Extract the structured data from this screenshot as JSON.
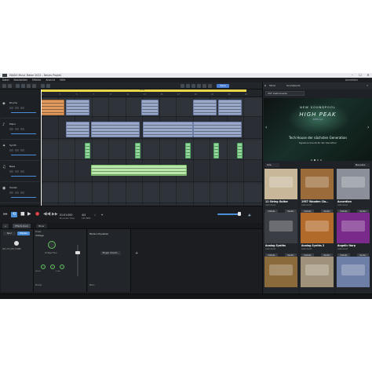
{
  "window": {
    "title": "MAGIX Music Maker 2022 – Neues Projekt",
    "controls": [
      "–",
      "☐",
      "✕"
    ]
  },
  "menu": [
    "Datei",
    "Bearbeiten",
    "Effekte",
    "Ansicht",
    "Hilfe"
  ],
  "toolbar": {
    "action_label": "Save"
  },
  "right_top": {
    "account_label": "Anmelden"
  },
  "ruler": {
    "loop_label": "Loop",
    "ticks": [
      "1",
      "3",
      "5",
      "7",
      "9",
      "11",
      "13",
      "15",
      "17",
      "19",
      "21",
      "23",
      "25"
    ]
  },
  "tracks": [
    {
      "name": "Drums",
      "icon": "drum-icon",
      "glyph": "◈"
    },
    {
      "name": "Piano",
      "icon": "keys-icon",
      "glyph": "♪"
    },
    {
      "name": "Synth",
      "icon": "synth-icon",
      "glyph": "✦"
    },
    {
      "name": "Bass",
      "icon": "bass-icon",
      "glyph": "♫"
    },
    {
      "name": "Vocals",
      "icon": "mic-icon",
      "glyph": "◉"
    }
  ],
  "transport": {
    "position": "01:01:000",
    "position_sub": "No Audio Time",
    "tempo": "4/4",
    "tempo_sub": "120 BPM"
  },
  "fx_tabs": [
    "Effects Rack",
    "Mixer"
  ],
  "bottom": {
    "channel_tab_a": "Spur",
    "channel_tab_b": "Master",
    "preset_label": "Preset",
    "track_name": "003_07X_DRY_TURBO",
    "plugin_title": "Vintage",
    "plugin_knob_label": "Vintage Tone",
    "plugin_bottom": "250 Hz",
    "plugin_bottom2": "3 kHz",
    "plugin_footer": "Drums",
    "eq_title": "Modern Equalizer",
    "eq_add": "Plugin hinzuf…",
    "eq_footer": "Mono",
    "add_symbol": "+"
  },
  "right_panel": {
    "tabs": [
      "Store",
      "Soundpools"
    ],
    "category": "VST Instruments",
    "banner": {
      "line1": "NEW SOUNDPOOL",
      "line2": "HIGH PEAK",
      "line3": "PART 1+2",
      "line4": "Tech House der nächsten Generation",
      "line5": "Signature Sounds für den Dancefloor"
    },
    "filter": "Alle",
    "filter2": "Neueste",
    "buy_label": "Kaufen",
    "detail_label": "Details",
    "products": [
      {
        "title": "12 String Guitar",
        "sub": "Instrument",
        "price": "",
        "bg": "#c9b79a"
      },
      {
        "title": "1957 Wooden Cla…",
        "sub": "Instrument",
        "price": "29,99 €",
        "bg": "#9b6b3a"
      },
      {
        "title": "Accordion",
        "sub": "Instrument",
        "price": "29,99 €",
        "bg": "#8a8f99"
      },
      {
        "title": "Analog Synths",
        "sub": "Instrument",
        "price": "",
        "bg": "#3a3d44"
      },
      {
        "title": "Analog Synths 2",
        "sub": "Instrument",
        "price": "29,99 €",
        "bg": "#b26a2a"
      },
      {
        "title": "Angelic Harp",
        "sub": "Instrument",
        "price": "29,99 €",
        "bg": "#7a2a8a"
      },
      {
        "title": "",
        "sub": "",
        "price": "",
        "bg": "#8a6a3a"
      },
      {
        "title": "",
        "sub": "",
        "price": "",
        "bg": "#a0917a"
      },
      {
        "title": "",
        "sub": "",
        "price": "",
        "bg": "#6d7fa7"
      }
    ]
  },
  "colors": {
    "accent": "#4a8fd8",
    "loop": "#e8d84a",
    "clip_blue": "#9aa9c9",
    "clip_orange": "#e09a60",
    "clip_green": "#8fd89a",
    "knob": "#5fbf5a"
  }
}
